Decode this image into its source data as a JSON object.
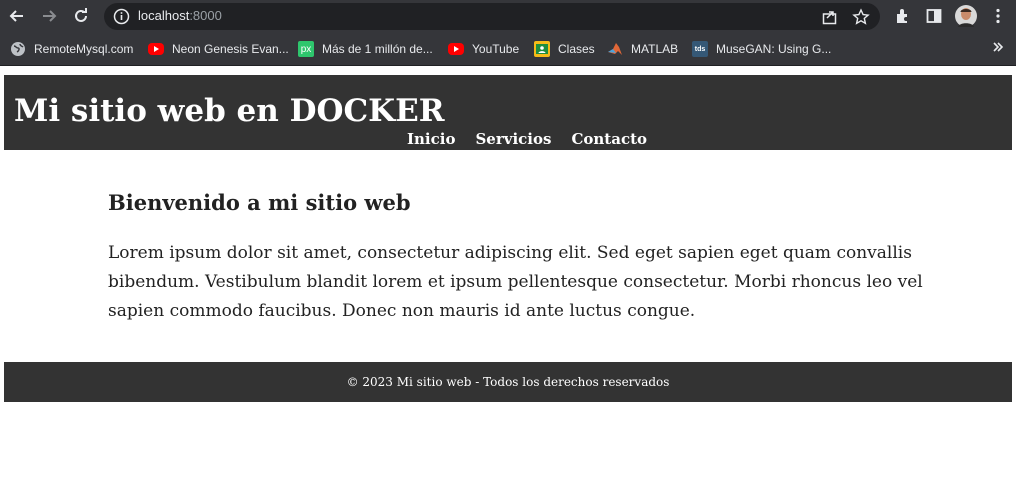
{
  "browser": {
    "url_host": "localhost",
    "url_port": ":8000",
    "bookmarks": [
      {
        "label": "RemoteMysql.com",
        "icon": "globe-icon"
      },
      {
        "label": "Neon Genesis Evan...",
        "icon": "youtube-icon"
      },
      {
        "label": "Más de 1 millón de...",
        "icon": "pixabay-icon"
      },
      {
        "label": "YouTube",
        "icon": "youtube-icon"
      },
      {
        "label": "Clases",
        "icon": "classroom-icon"
      },
      {
        "label": "MATLAB",
        "icon": "matlab-icon"
      },
      {
        "label": "MuseGAN: Using G...",
        "icon": "tds-icon"
      }
    ],
    "bookmark_tds_text": "tds",
    "bookmark_px_text": "px"
  },
  "site": {
    "title": "Mi sitio web en DOCKER",
    "nav": [
      "Inicio",
      "Servicios",
      "Contacto"
    ],
    "heading": "Bienvenido a mi sitio web",
    "paragraph": "Lorem ipsum dolor sit amet, consectetur adipiscing elit. Sed eget sapien eget quam convallis bibendum. Vestibulum blandit lorem et ipsum pellentesque consectetur. Morbi rhoncus leo vel sapien commodo faucibus. Donec non mauris id ante luctus congue.",
    "footer": "© 2023 Mi sitio web - Todos los derechos reservados"
  },
  "colors": {
    "chrome_bg": "#35363a",
    "omnibox_bg": "#202124",
    "site_bar": "#333333"
  }
}
